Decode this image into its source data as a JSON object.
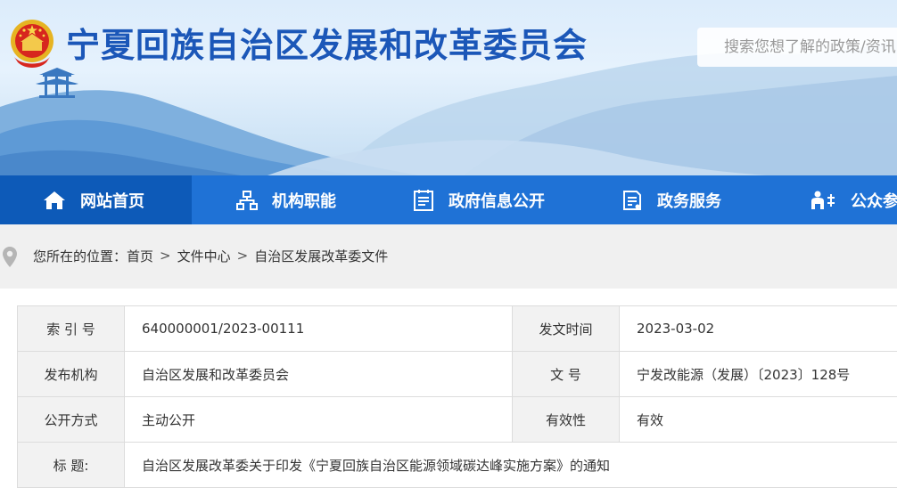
{
  "header": {
    "site_title": "宁夏回族自治区发展和改革委员会",
    "search_placeholder": "搜索您想了解的政策/资讯"
  },
  "nav": {
    "items": [
      {
        "label": "网站首页",
        "icon": "home-icon"
      },
      {
        "label": "机构职能",
        "icon": "org-chart-icon"
      },
      {
        "label": "政府信息公开",
        "icon": "document-list-icon"
      },
      {
        "label": "政务服务",
        "icon": "service-icon"
      },
      {
        "label": "公众参与",
        "icon": "public-participation-icon"
      }
    ],
    "active_index": 0
  },
  "breadcrumb": {
    "prefix": "您所在的位置：",
    "items": [
      "首页",
      "文件中心",
      "自治区发展改革委文件"
    ],
    "separator": ">"
  },
  "info": {
    "rows": [
      {
        "l1": "索 引 号",
        "v1": "640000001/2023-00111",
        "l2": "发文时间",
        "v2": "2023-03-02"
      },
      {
        "l1": "发布机构",
        "v1": "自治区发展和改革委员会",
        "l2": "文 号",
        "v2": "宁发改能源（发展）〔2023〕128号"
      },
      {
        "l1": "公开方式",
        "v1": "主动公开",
        "l2": "有效性",
        "v2": "有效"
      }
    ],
    "title_label": "标 题:",
    "title_value": "自治区发展改革委关于印发《宁夏回族自治区能源领域碳达峰实施方案》的通知"
  },
  "colors": {
    "nav_bg": "#1f72d6",
    "nav_active": "#0d5ab8",
    "title_blue": "#1b57b8",
    "label_bg": "#f2f2f2",
    "border": "#dcdcdc"
  }
}
